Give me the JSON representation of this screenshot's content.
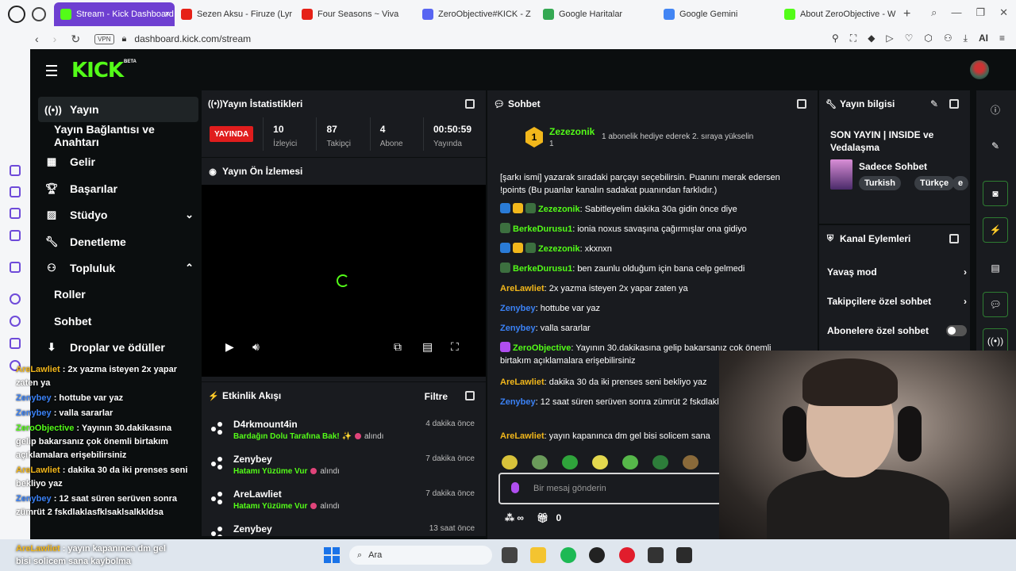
{
  "browser": {
    "tabs": [
      {
        "label": "Stream - Kick Dashboard",
        "active": true,
        "favicon": "kick-icon",
        "color": "#53fc18"
      },
      {
        "label": "Sezen Aksu - Firuze (Lyr",
        "active": false,
        "favicon": "youtube-icon",
        "color": "#e62117"
      },
      {
        "label": "Four Seasons ~ Viva",
        "active": false,
        "favicon": "youtube-icon",
        "color": "#e62117"
      },
      {
        "label": "ZeroObjective#KICK - Z",
        "active": false,
        "favicon": "discord-icon",
        "color": "#5865f2"
      },
      {
        "label": "Google Haritalar",
        "active": false,
        "favicon": "maps-icon",
        "color": "#34a853"
      },
      {
        "label": "Google Gemini",
        "active": false,
        "favicon": "gemini-icon",
        "color": "#4285f4"
      },
      {
        "label": "About ZeroObjective - W",
        "active": false,
        "favicon": "kick-icon",
        "color": "#53fc18"
      }
    ],
    "vpn_label": "VPN",
    "url": "dashboard.kick.com/stream",
    "ai_label": "AI"
  },
  "nav": {
    "items": [
      {
        "label": "Yayın",
        "icon": "broadcast-icon",
        "active": true,
        "sub": false
      },
      {
        "label": "Yayın Bağlantısı ve Anahtarı",
        "icon": "",
        "active": false,
        "sub": true
      },
      {
        "label": "Gelir",
        "icon": "revenue-icon",
        "active": false,
        "sub": false
      },
      {
        "label": "Başarılar",
        "icon": "trophy-icon",
        "active": false,
        "sub": false
      },
      {
        "label": "Stüdyo",
        "icon": "studio-icon",
        "active": false,
        "sub": false,
        "chevron": "down"
      },
      {
        "label": "Denetleme",
        "icon": "wrench-icon",
        "active": false,
        "sub": false
      },
      {
        "label": "Topluluk",
        "icon": "community-icon",
        "active": false,
        "sub": false,
        "chevron": "up"
      },
      {
        "label": "Roller",
        "icon": "",
        "active": false,
        "sub": true
      },
      {
        "label": "Sohbet",
        "icon": "",
        "active": false,
        "sub": true
      },
      {
        "label": "Droplar ve ödüller",
        "icon": "drops-icon",
        "active": false,
        "sub": false
      }
    ]
  },
  "stats": {
    "title": "Yayın İstatistikleri",
    "live_label": "YAYINDA",
    "items": [
      {
        "value": "10",
        "label": "İzleyici"
      },
      {
        "value": "87",
        "label": "Takipçi"
      },
      {
        "value": "4",
        "label": "Abone"
      },
      {
        "value": "00:50:59",
        "label": "Yayında"
      }
    ]
  },
  "preview": {
    "title": "Yayın Ön İzlemesi"
  },
  "feed": {
    "title": "Etkinlik Akışı",
    "filter_label": "Filtre",
    "items": [
      {
        "user": "D4rkmount4in",
        "time": "4 dakika önce",
        "reward": "Bardağın Dolu Tarafına Bak! ✨",
        "action": "alındı"
      },
      {
        "user": "Zenybey",
        "time": "7 dakika önce",
        "reward": "Hatamı Yüzüme Vur",
        "action": "alındı"
      },
      {
        "user": "AreLawliet",
        "time": "7 dakika önce",
        "reward": "Hatamı Yüzüme Vur",
        "action": "alındı"
      },
      {
        "user": "Zenybey",
        "time": "13 saat önce",
        "reward": "",
        "action": ""
      }
    ]
  },
  "chat": {
    "title": "Sohbet",
    "pinned": {
      "badge": "1",
      "name": "Zezezonik",
      "sub": "1",
      "message": "1 abonelik hediye ederek 2. sıraya yükselin"
    },
    "messages": [
      {
        "user": "",
        "color": "#ffffff",
        "text": "[şarkı ismi] yazarak sıradaki parçayı seçebilirsin. Puanını merak edersen !points (Bu puanlar kanalın sadakat puanından farklıdır.)"
      },
      {
        "user": "Zezezonik",
        "color": "#53fc18",
        "text": ": Sabitleyelim dakika 30a gidin önce diye"
      },
      {
        "user": "BerkeDurusu1",
        "color": "#53fc18",
        "text": ": ionia noxus savaşına çağırmışlar ona gidiyo"
      },
      {
        "user": "Zezezonik",
        "color": "#53fc18",
        "text": ": xkxnxn"
      },
      {
        "user": "BerkeDurusu1",
        "color": "#53fc18",
        "text": ": ben zaunlu olduğum için bana celp gelmedi"
      },
      {
        "user": "AreLawliet",
        "color": "#f2b71b",
        "text": ": 2x yazma isteyen 2x yapar zaten ya"
      },
      {
        "user": "Zenybey",
        "color": "#3b82f6",
        "text": ": hottube var yaz"
      },
      {
        "user": "Zenybey",
        "color": "#3b82f6",
        "text": ": valla sararlar"
      },
      {
        "user": "ZeroObjective",
        "color": "#53fc18",
        "text": ": Yayının 30.dakikasına gelip bakarsanız çok önemli birtakım açıklamalara erişebilirsiniz"
      },
      {
        "user": "AreLawliet",
        "color": "#f2b71b",
        "text": ": dakika 30 da iki prenses seni bekliyo yaz"
      },
      {
        "user": "Zenybey",
        "color": "#3b82f6",
        "text": ": 12 saat süren serüven sonra zümrüt 2 fskdlaklasfklsaklsalkkldsa"
      },
      {
        "user": "AreLawliet",
        "color": "#f2b71b",
        "text": ": yayın kapanınca dm gel bisi solicem sana"
      }
    ],
    "input_placeholder": "Bir mesaj gönderin",
    "points_label": "∞",
    "gift_count": "0"
  },
  "stream_info": {
    "title_label": "Yayın bilgisi",
    "stream_title": "SON YAYIN | INSIDE ve Vedalaşma",
    "category": "Sadece Sohbet",
    "tags": [
      "Turkish",
      "Türkçe",
      "e"
    ]
  },
  "channel_actions": {
    "title": "Kanal Eylemleri",
    "items": [
      {
        "label": "Yavaş mod",
        "control": "chevron"
      },
      {
        "label": "Takipçilere özel sohbet",
        "control": "chevron"
      },
      {
        "label": "Abonelere özel sohbet",
        "control": "toggle",
        "on": false
      }
    ]
  },
  "overlay_chat": [
    {
      "user": "AreLawliet",
      "color": "#f2b71b",
      "text": " : 2x yazma isteyen 2x yapar zaten ya"
    },
    {
      "user": "Zenybey",
      "color": "#3b82f6",
      "text": " : hottube var yaz"
    },
    {
      "user": "Zenybey",
      "color": "#3b82f6",
      "text": " : valla sararlar"
    },
    {
      "user": "ZeroObjective",
      "color": "#53fc18",
      "text": " : Yayının 30.dakikasına gelip bakarsanız çok önemli birtakım açıklamalara erişebilirsiniz"
    },
    {
      "user": "AreLawliet",
      "color": "#f2b71b",
      "text": " : dakika 30 da iki prenses seni bekliyo yaz"
    },
    {
      "user": "Zenybey",
      "color": "#3b82f6",
      "text": " : 12 saat süren serüven sonra zümrüt 2 fskdlaklasfklsaklsalkkldsa"
    },
    {
      "user": "AreLawliet",
      "color": "#f2b71b",
      "text": " : yayın kapanınca dm gel bisi solicem sana kaybolma"
    }
  ],
  "taskbar": {
    "search_label": "Ara"
  }
}
